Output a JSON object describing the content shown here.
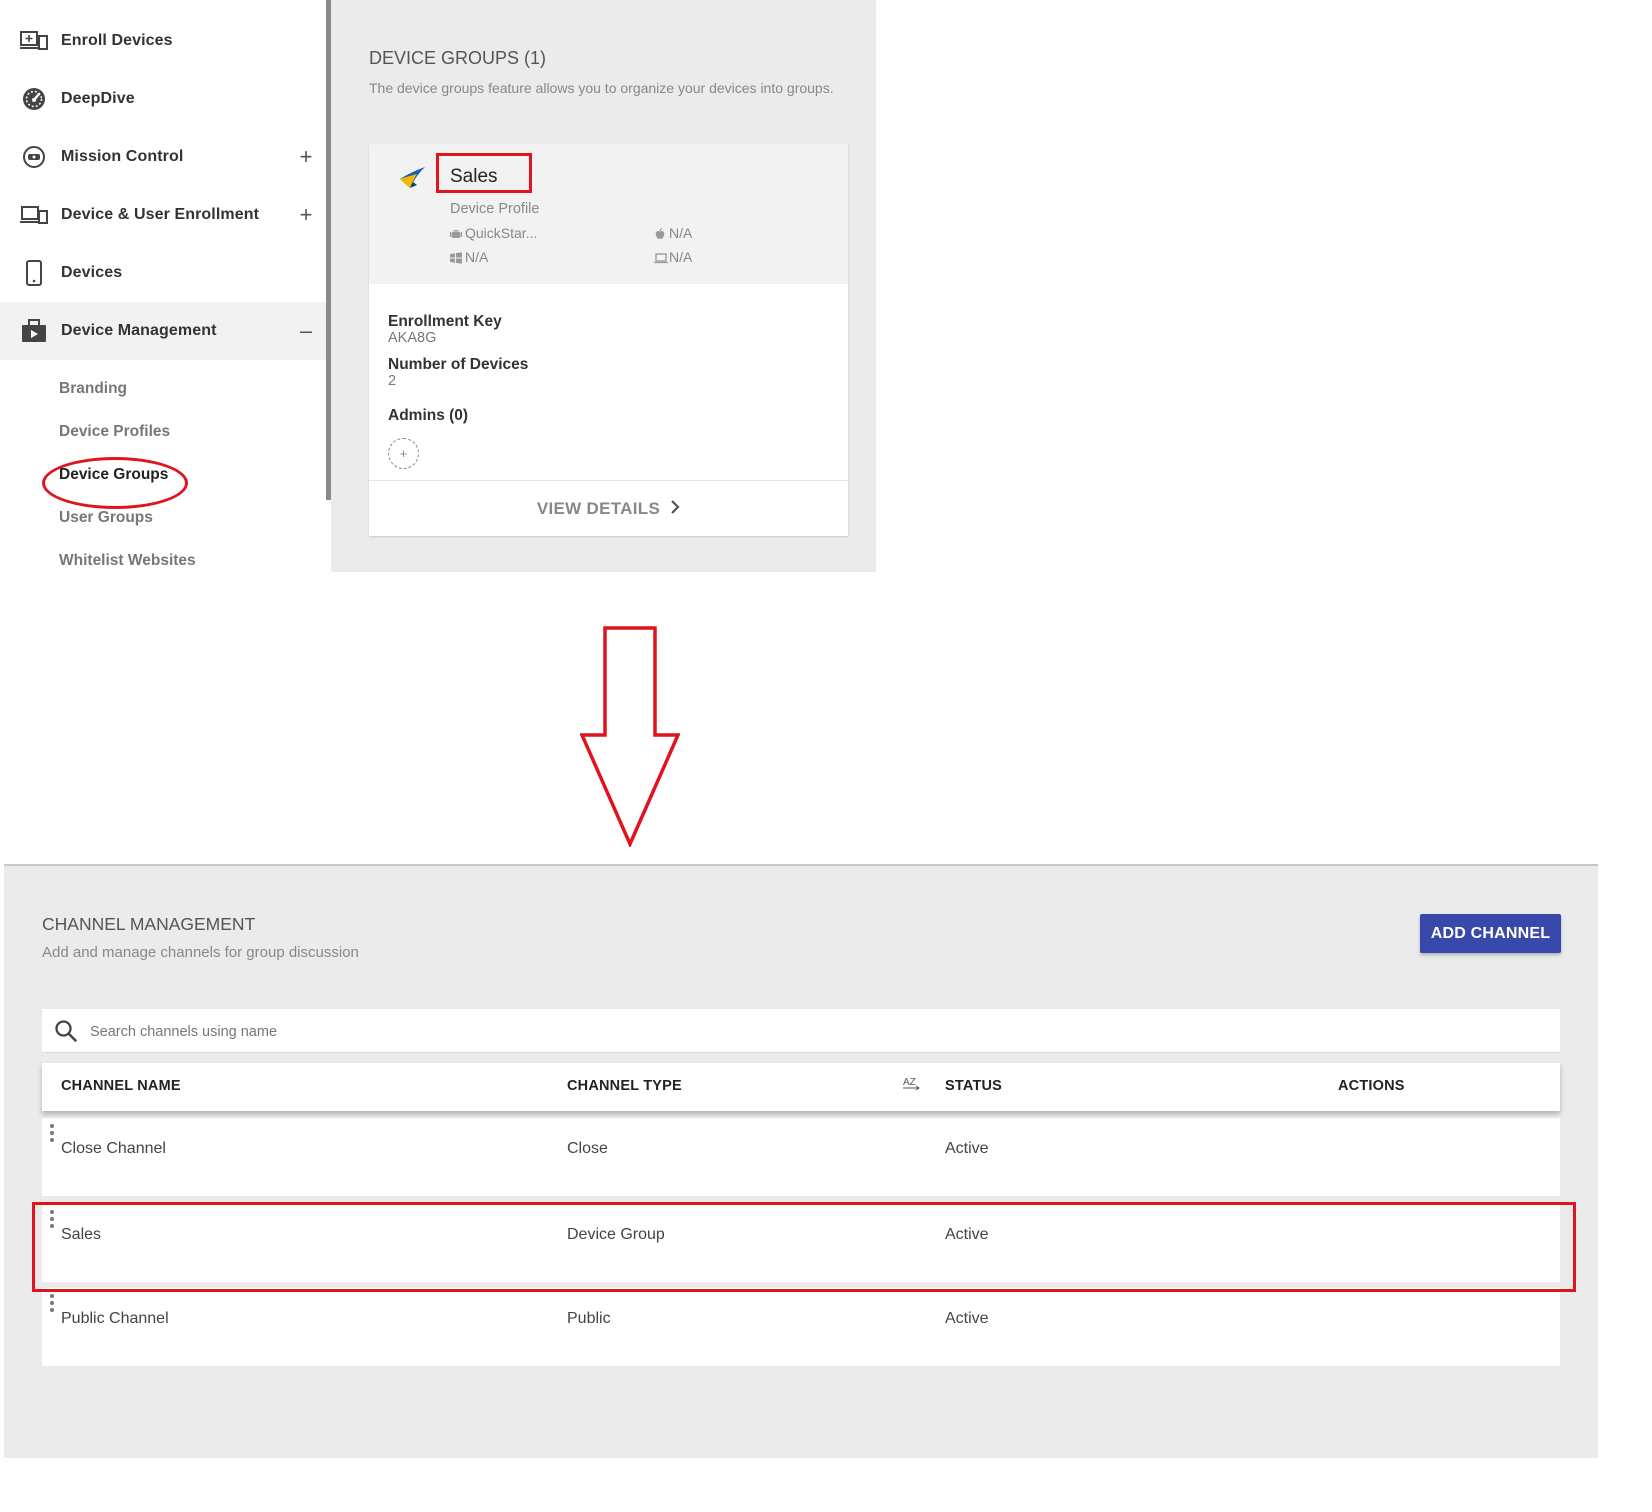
{
  "sidebar": {
    "nav_items": [
      {
        "label": "Enroll Devices",
        "icon": "enroll-devices-icon"
      },
      {
        "label": "DeepDive",
        "icon": "speedometer-icon"
      },
      {
        "label": "Mission Control",
        "icon": "mission-control-icon",
        "toggle": "+"
      },
      {
        "label": "Device & User Enrollment",
        "icon": "devices-enrollment-icon",
        "toggle": "+"
      },
      {
        "label": "Devices",
        "icon": "phone-icon"
      },
      {
        "label": "Device Management",
        "icon": "briefcase-icon",
        "toggle": "–"
      }
    ],
    "sub_items": [
      "Branding",
      "Device Profiles",
      "Device Groups",
      "User Groups",
      "Whitelist Websites"
    ],
    "selected_sub_item": "Device Groups"
  },
  "device_groups": {
    "title": "DEVICE GROUPS (1)",
    "subtitle": "The device groups feature allows you to organize your devices into groups.",
    "card": {
      "name": "Sales",
      "profile_label": "Device Profile",
      "os_profiles": {
        "android": "QuickStar...",
        "apple": "N/A",
        "windows": "N/A",
        "other": "N/A"
      },
      "enrollment_key_label": "Enrollment Key",
      "enrollment_key": "AKA8G",
      "num_devices_label": "Number of Devices",
      "num_devices": "2",
      "admins_label": "Admins (0)",
      "add_admin_glyph": "+",
      "view_details": "VIEW DETAILS"
    }
  },
  "channel_management": {
    "title": "CHANNEL MANAGEMENT",
    "subtitle": "Add and manage channels for group discussion",
    "add_button": "ADD CHANNEL",
    "search_placeholder": "Search channels using name",
    "columns": {
      "name": "CHANNEL NAME",
      "type": "CHANNEL TYPE",
      "status": "STATUS",
      "actions": "ACTIONS"
    },
    "sort_glyph": "AZ",
    "rows": [
      {
        "name": "Close Channel",
        "type": "Close",
        "status": "Active"
      },
      {
        "name": "Sales",
        "type": "Device Group",
        "status": "Active"
      },
      {
        "name": "Public Channel",
        "type": "Public",
        "status": "Active"
      }
    ]
  },
  "colors": {
    "accent_button": "#3949ab",
    "annotation_red": "#e0141e",
    "panel_bg": "#ebebeb"
  }
}
